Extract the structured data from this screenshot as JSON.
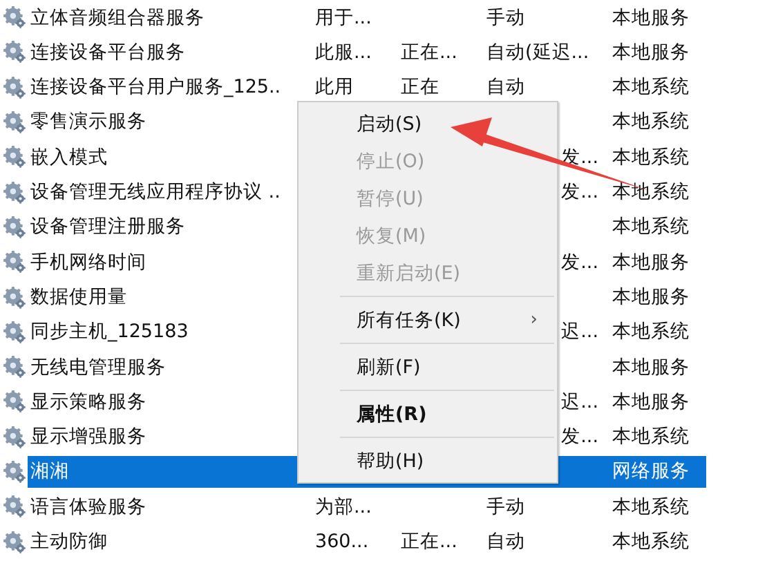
{
  "services": [
    {
      "name": "立体音频组合器服务",
      "description": "用于...",
      "startup": "手动",
      "logon": "本地服务",
      "selected": false
    },
    {
      "name": "连接设备平台服务",
      "description": "此服...",
      "status": "正在...",
      "startup": "自动(延迟...",
      "logon": "本地服务",
      "selected": false
    },
    {
      "name": "连接设备平台用户服务_125..",
      "description": "此用",
      "status": "正在",
      "startup": "自动",
      "logon": "本地系统",
      "selected": false
    },
    {
      "name": "零售演示服务",
      "logon": "本地系统",
      "selected": false
    },
    {
      "name": "嵌入模式",
      "startup": "发...",
      "logon": "本地系统",
      "selected": false
    },
    {
      "name": "设备管理无线应用程序协议 ..",
      "startup": "发...",
      "logon": "本地系统",
      "selected": false
    },
    {
      "name": "设备管理注册服务",
      "logon": "本地系统",
      "selected": false
    },
    {
      "name": "手机网络时间",
      "startup": "发...",
      "logon": "本地服务",
      "selected": false
    },
    {
      "name": "数据使用量",
      "logon": "本地服务",
      "selected": false
    },
    {
      "name": "同步主机_125183",
      "startup": "迟...",
      "logon": "本地系统",
      "selected": false
    },
    {
      "name": "无线电管理服务",
      "logon": "本地服务",
      "selected": false
    },
    {
      "name": "显示策略服务",
      "startup": "迟...",
      "logon": "本地服务",
      "selected": false
    },
    {
      "name": "显示增强服务",
      "startup": "发...",
      "logon": "本地系统",
      "selected": false
    },
    {
      "name": "湘湘",
      "logon": "网络服务",
      "selected": true
    },
    {
      "name": "语言体验服务",
      "description": "为部...",
      "startup": "手动",
      "logon": "本地系统",
      "selected": false
    },
    {
      "name": "主动防御",
      "description": "360...",
      "status": "正在...",
      "startup": "自动",
      "logon": "本地系统",
      "selected": false
    }
  ],
  "context_menu": [
    {
      "kind": "item",
      "label": "启动(S)",
      "disabled": false,
      "default": false
    },
    {
      "kind": "item",
      "label": "停止(O)",
      "disabled": true,
      "default": false
    },
    {
      "kind": "item",
      "label": "暂停(U)",
      "disabled": true,
      "default": false
    },
    {
      "kind": "item",
      "label": "恢复(M)",
      "disabled": true,
      "default": false
    },
    {
      "kind": "item",
      "label": "重新启动(E)",
      "disabled": true,
      "default": false
    },
    {
      "kind": "separator"
    },
    {
      "kind": "item",
      "label": "所有任务(K)",
      "disabled": false,
      "default": false,
      "submenu_mark": "›"
    },
    {
      "kind": "separator"
    },
    {
      "kind": "item",
      "label": "刷新(F)",
      "disabled": false,
      "default": false
    },
    {
      "kind": "separator"
    },
    {
      "kind": "item",
      "label": "属性(R)",
      "disabled": false,
      "default": true
    },
    {
      "kind": "separator"
    },
    {
      "kind": "item",
      "label": "帮助(H)",
      "disabled": false,
      "default": false
    }
  ],
  "annotation": {
    "kind": "arrow"
  }
}
